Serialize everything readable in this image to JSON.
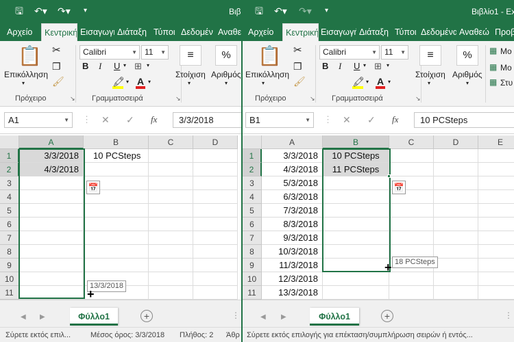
{
  "left_window": {
    "title": "Βιβ",
    "tabs": [
      "Αρχείο",
      "Κεντρική",
      "Εισαγωγή",
      "Διάταξη",
      "Τύποι",
      "Δεδομέν",
      "Αναθεώ"
    ],
    "ribbon": {
      "paste_label": "Επικόλληση",
      "clipboard_label": "Πρόχειρο",
      "font_name": "Calibri",
      "font_size": "11",
      "font_group_label": "Γραμματοσειρά",
      "alignment_label": "Στοίχιση",
      "number_label": "Αριθμός",
      "percent_symbol": "%",
      "bold": "B",
      "italic": "I",
      "underline": "U",
      "font_color_letter": "A"
    },
    "name_box": "A1",
    "formula_value": "3/3/2018",
    "fx_label": "fx",
    "columns": [
      "A",
      "B",
      "C",
      "D"
    ],
    "rows": [
      "1",
      "2",
      "3",
      "4",
      "5",
      "6",
      "7",
      "8",
      "9",
      "10",
      "11"
    ],
    "cells": {
      "A1": "3/3/2018",
      "A2": "4/3/2018",
      "B1": "10 PCSteps"
    },
    "tooltip": "13/3/2018",
    "sheet_tab": "Φύλλο1",
    "status": {
      "left": "Σύρετε εκτός επιλ...",
      "average": "Μέσος όρος: 3/3/2018",
      "count": "Πλήθος: 2",
      "sum": "Άθρ"
    }
  },
  "right_window": {
    "title": "Βιβλίο1 - Ex",
    "tabs": [
      "Αρχείο",
      "Κεντρική",
      "Εισαγωγή",
      "Διάταξη",
      "Τύποι",
      "Δεδομένα",
      "Αναθεώ",
      "Προβ"
    ],
    "ribbon": {
      "paste_label": "Επικόλληση",
      "clipboard_label": "Πρόχειρο",
      "font_name": "Calibri",
      "font_size": "11",
      "font_group_label": "Γραμματοσειρά",
      "alignment_label": "Στοίχιση",
      "number_label": "Αριθμός",
      "percent_symbol": "%",
      "bold": "B",
      "italic": "I",
      "underline": "U",
      "font_color_letter": "A",
      "styles": [
        "Μο",
        "Μο",
        "Στυ"
      ]
    },
    "name_box": "B1",
    "formula_value": "10 PCSteps",
    "fx_label": "fx",
    "columns": [
      "A",
      "B",
      "C",
      "D",
      "E"
    ],
    "rows": [
      "1",
      "2",
      "3",
      "4",
      "5",
      "6",
      "7",
      "8",
      "9",
      "10",
      "11"
    ],
    "col_a_values": [
      "3/3/2018",
      "4/3/2018",
      "5/3/2018",
      "6/3/2018",
      "7/3/2018",
      "8/3/2018",
      "9/3/2018",
      "10/3/2018",
      "11/3/2018",
      "12/3/2018",
      "13/3/2018"
    ],
    "cells": {
      "B1": "10 PCSteps",
      "B2": "11 PCSteps"
    },
    "tooltip": "18 PCSteps",
    "sheet_tab": "Φύλλο1",
    "status": {
      "left": "Σύρετε εκτός επιλογής για επέκταση/συμπλήρωση σειρών ή εντός..."
    }
  },
  "colors": {
    "accent": "#217346",
    "ribbon_bg": "#f3f3f3",
    "font_red": "#e02020",
    "highlight_yellow": "#ffff00"
  }
}
